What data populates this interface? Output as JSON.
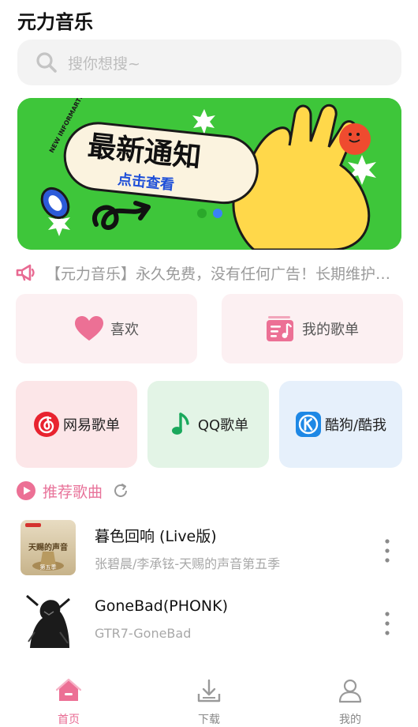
{
  "app": {
    "title": "元力音乐"
  },
  "search": {
    "placeholder": "搜你想搜~"
  },
  "banner": {
    "tag": "NEW INFORMARTION",
    "headline": "最新通知",
    "sub": "点击查看",
    "page_count": 2,
    "active_page": 2
  },
  "notice": {
    "text": "【元力音乐】永久免费，没有任何广告！长期维护更新"
  },
  "quick": {
    "favorites": "喜欢",
    "my_playlists": "我的歌单"
  },
  "sources": {
    "netease": "网易歌单",
    "qq": "QQ歌单",
    "kugou": "酷狗/酷我"
  },
  "recommend": {
    "title": "推荐歌曲",
    "songs": [
      {
        "title": "暮色回响 (Live版)",
        "artist": "张碧晨/李承铉-天赐的声音第五季",
        "cover_text": "天赐的声音",
        "cover_sub": "第五季"
      },
      {
        "title": "GoneBad(PHONK)",
        "artist": "GTR7-GoneBad"
      }
    ]
  },
  "tabs": [
    {
      "label": "首页",
      "icon": "home-icon"
    },
    {
      "label": "下载",
      "icon": "download-icon"
    },
    {
      "label": "我的",
      "icon": "user-icon"
    }
  ],
  "colors": {
    "accent": "#e86a92",
    "banner_green": "#3ec63a",
    "netease_red": "#e8232f",
    "qq_green": "#1aa85c",
    "kugou_blue": "#1e88e5"
  }
}
